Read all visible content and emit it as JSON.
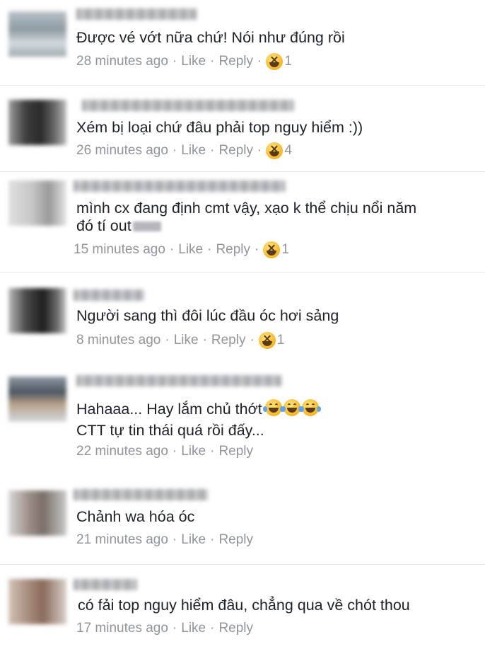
{
  "comments": [
    {
      "text": "Được vé vớt nữa chứ! Nói như đúng rồi",
      "time": "28 minutes ago",
      "like": "Like",
      "reply": "Reply",
      "reaction_icon": "laughing-emoji",
      "reaction_count": "1"
    },
    {
      "text": "Xém bị loại chứ đâu phải top nguy hiểm :))",
      "time": "26 minutes ago",
      "like": "Like",
      "reply": "Reply",
      "reaction_icon": "laughing-emoji",
      "reaction_count": "4"
    },
    {
      "text_line1": "mình cx đang định cmt vậy, xạo k thể chịu nổi năm",
      "text_line2": "đó tí out",
      "time": "15 minutes ago",
      "like": "Like",
      "reply": "Reply",
      "reaction_icon": "laughing-emoji",
      "reaction_count": "1"
    },
    {
      "text": "Người sang thì đôi lúc đầu óc hơi sảng",
      "time": "8 minutes ago",
      "like": "Like",
      "reply": "Reply",
      "reaction_icon": "laughing-emoji",
      "reaction_count": "1"
    },
    {
      "text_line1": "Hahaaa... Hay lắm chủ thớt",
      "inline_emoji": "tears-of-joy-emoji",
      "text_line2": "CTT tự tin thái quá rồi đấy...",
      "time": "22 minutes ago",
      "like": "Like",
      "reply": "Reply"
    },
    {
      "text": "Chảnh wa hóa óc",
      "time": "21 minutes ago",
      "like": "Like",
      "reply": "Reply"
    },
    {
      "text": "có fải top nguy hiểm đâu, chẳng qua về chót thou",
      "time": "17 minutes ago",
      "like": "Like",
      "reply": "Reply"
    }
  ],
  "separator": "·",
  "colors": {
    "text": "#1d2129",
    "meta": "#90949c",
    "divider": "#e6e7ea"
  }
}
